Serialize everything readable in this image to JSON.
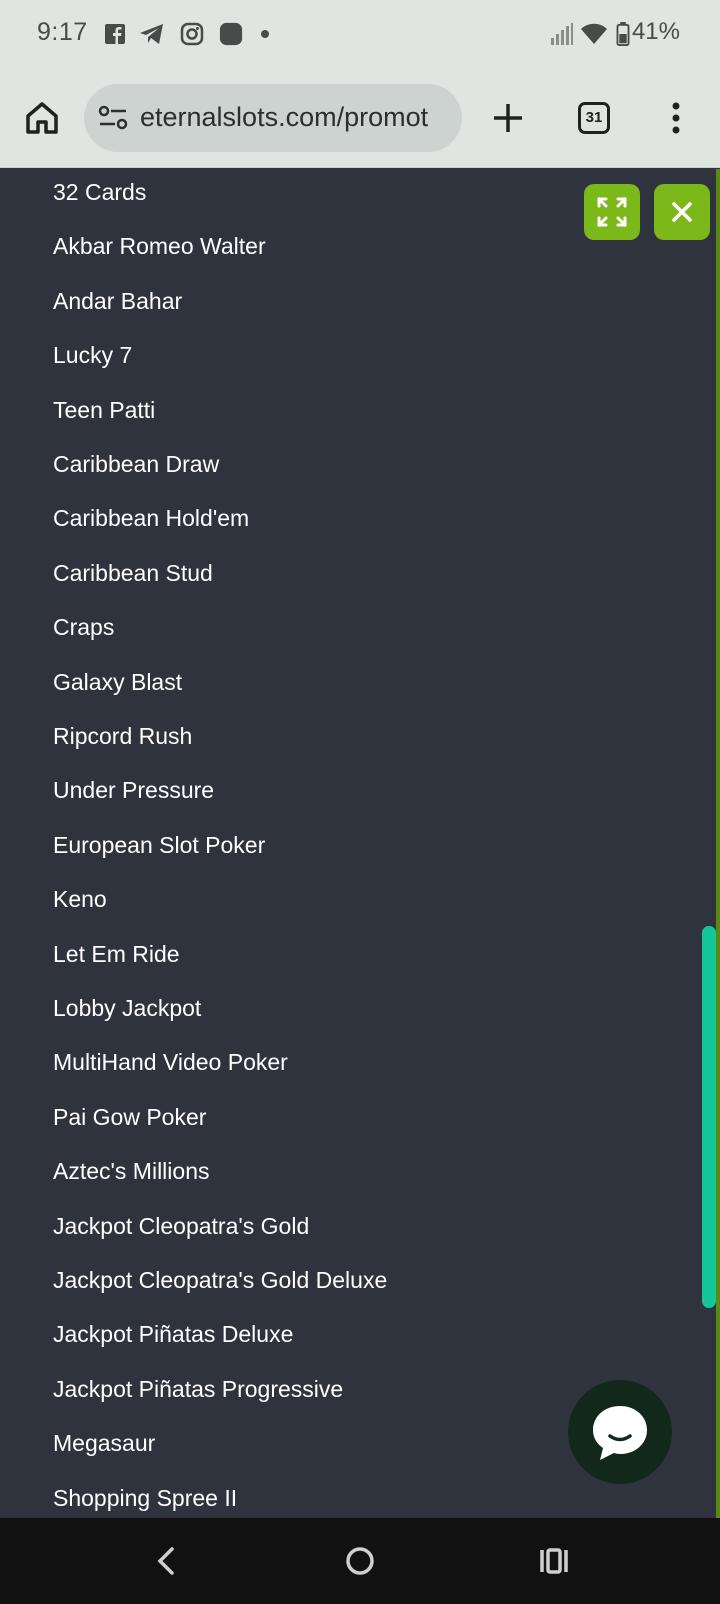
{
  "status_bar": {
    "time": "9:17",
    "left_icons": [
      "facebook-icon",
      "telegram-icon",
      "instagram-icon",
      "app-icon",
      "notification-dot-icon"
    ],
    "battery": "41%",
    "right_icons": [
      "signal-icon",
      "wifi-icon",
      "battery-icon"
    ]
  },
  "browser": {
    "url": "eternalslots.com/promot",
    "tab_count": "31"
  },
  "games": [
    "32 Cards",
    "Akbar Romeo Walter",
    "Andar Bahar",
    "Lucky 7",
    "Teen Patti",
    "Caribbean Draw",
    "Caribbean Hold'em",
    "Caribbean Stud",
    "Craps",
    "Galaxy Blast",
    "Ripcord Rush",
    "Under Pressure",
    "European Slot Poker",
    "Keno",
    "Let Em Ride",
    "Lobby Jackpot",
    "MultiHand Video Poker",
    "Pai Gow Poker",
    "Aztec's Millions",
    "Jackpot Cleopatra's Gold",
    "Jackpot Cleopatra's Gold Deluxe",
    "Jackpot Piñatas Deluxe",
    "Jackpot Piñatas Progressive",
    "Megasaur",
    "Shopping Spree II"
  ],
  "colors": {
    "page_bg": "#2f333d",
    "accent_green": "#7db81a",
    "scrollbar": "#13c79a",
    "chat_bg": "#12281b"
  }
}
